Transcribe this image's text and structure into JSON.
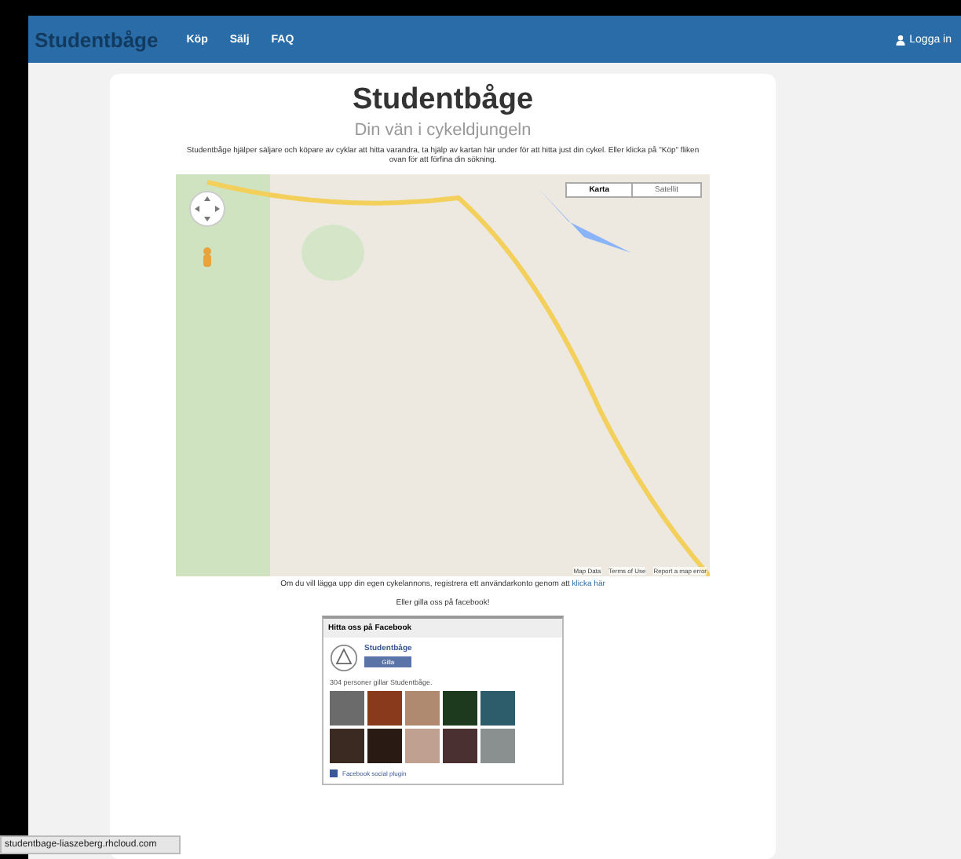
{
  "navbar": {
    "brand": "Studentbåge",
    "links": [
      {
        "label": "Köp",
        "selected": false
      },
      {
        "label": "Sälj",
        "selected": false
      },
      {
        "label": "FAQ",
        "selected": false
      }
    ],
    "login": "Logga in"
  },
  "header": {
    "title": "Studentbåge",
    "subtitle": "Din vän i cykeldjungeln",
    "description": "Studentbåge hjälper säljare och köpare av cyklar att hitta varandra, ta hjälp av kartan här under för att hitta just din cykel. Eller klicka på \"Köp\" fliken ovan för att förfina din sökning."
  },
  "map": {
    "types": [
      {
        "label": "Karta",
        "selected": true
      },
      {
        "label": "Satellit",
        "selected": false
      }
    ],
    "footer": [
      "Map Data",
      "Terms of Use",
      "Report a map error"
    ]
  },
  "register": {
    "text": "Om du vill lägga upp din egen cykelannons, registrera ett användarkonto genom att",
    "link": "klicka här"
  },
  "facebook": {
    "prompt": "Eller gilla oss på facebook!",
    "title": "Hitta oss på Facebook",
    "page": "Studentbåge",
    "like": "Gilla",
    "count": "304 personer gillar Studentbåge.",
    "plugin": "Facebook social plugin"
  },
  "status_bar": "studentbage-liaszeberg.rhcloud.com"
}
